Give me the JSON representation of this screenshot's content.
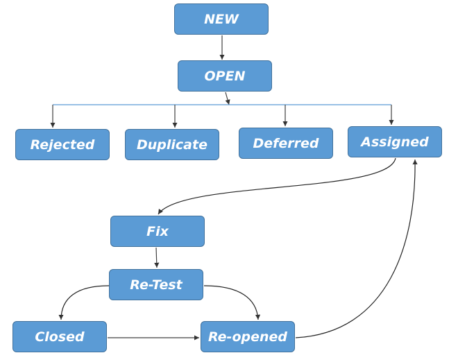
{
  "nodes": {
    "new": "NEW",
    "open": "OPEN",
    "rejected": "Rejected",
    "duplicate": "Duplicate",
    "deferred": "Deferred",
    "assigned": "Assigned",
    "fix": "Fix",
    "retest": "Re-Test",
    "closed": "Closed",
    "reopened": "Re-opened"
  },
  "colors": {
    "box_fill": "#5b9bd5",
    "box_border": "#41719c",
    "edge": "#404040",
    "branch_line": "#5b9bd5"
  }
}
